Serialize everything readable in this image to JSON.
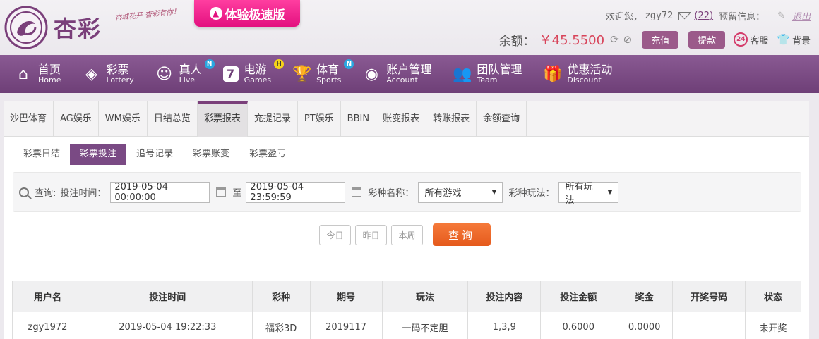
{
  "header": {
    "brand": "杏彩",
    "slogan": "杏城花开 杏彩有你！",
    "promo": "体验极速版",
    "welcome": "欢迎您，",
    "username": "zgy72",
    "mail_count": "(22)",
    "reserve_label": "预留信息：",
    "logout": "退出",
    "balance_label": "余额：",
    "balance_value": "￥45.5500",
    "recharge": "充值",
    "withdraw": "提款",
    "service": "客服",
    "background": "背景"
  },
  "nav": [
    {
      "cn": "首页",
      "en": "Home",
      "icon": "home-icon"
    },
    {
      "cn": "彩票",
      "en": "Lottery",
      "icon": "lottery-icon"
    },
    {
      "cn": "真人",
      "en": "Live",
      "icon": "live-icon",
      "badge": "N"
    },
    {
      "cn": "电游",
      "en": "Games",
      "icon": "games-icon",
      "badge": "H"
    },
    {
      "cn": "体育",
      "en": "Sports",
      "icon": "trophy-icon",
      "badge": "N"
    },
    {
      "cn": "账户管理",
      "en": "Account",
      "icon": "account-icon"
    },
    {
      "cn": "团队管理",
      "en": "Team",
      "icon": "team-icon"
    },
    {
      "cn": "优惠活动",
      "en": "Discount",
      "icon": "gift-icon"
    }
  ],
  "tabs": [
    "沙巴体育",
    "AG娱乐",
    "WM娱乐",
    "日结总览",
    "彩票报表",
    "充提记录",
    "PT娱乐",
    "BBIN",
    "账变报表",
    "转账报表",
    "余额查询"
  ],
  "active_tab": 4,
  "subtabs": [
    "彩票日结",
    "彩票投注",
    "追号记录",
    "彩票账变",
    "彩票盈亏"
  ],
  "active_subtab": 1,
  "filter": {
    "query_label": "查询:",
    "time_label": "投注时间：",
    "start": "2019-05-04 00:00:00",
    "to": "至",
    "end": "2019-05-04 23:59:59",
    "lottery_label": "彩种名称：",
    "lottery_value": "所有游戏",
    "play_label": "彩种玩法：",
    "play_value": "所有玩法"
  },
  "quick": {
    "today": "今日",
    "yesterday": "昨日",
    "week": "本周",
    "query": "查询"
  },
  "table": {
    "headers": [
      "用户名",
      "投注时间",
      "彩种",
      "期号",
      "玩法",
      "投注内容",
      "投注金额",
      "奖金",
      "开奖号码",
      "状态"
    ],
    "rows": [
      [
        "zgy1972",
        "2019-05-04 19:22:33",
        "福彩3D",
        "2019117",
        "一码不定胆",
        "1,3,9",
        "0.6000",
        "0.0000",
        "",
        "未开奖"
      ]
    ]
  },
  "colors": {
    "brand_purple": "#7a3f7a",
    "accent_orange": "#e55a1c",
    "balance_red": "#d8445a"
  }
}
